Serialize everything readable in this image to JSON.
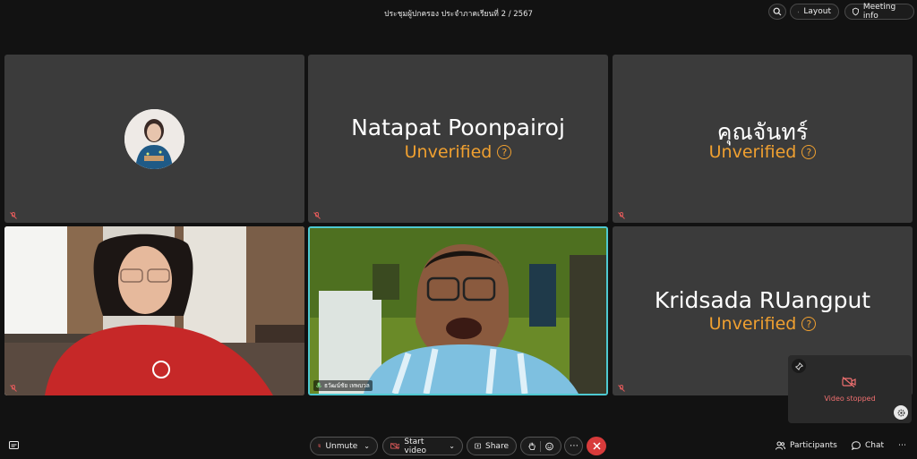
{
  "meeting": {
    "title": "ประชุมผู้ปกครอง ประจำภาคเรียนที่ 2 / 2567"
  },
  "top_buttons": {
    "layout": "Layout",
    "info": "Meeting info"
  },
  "participants": [
    {
      "name": "",
      "status": ""
    },
    {
      "name": "Natapat Poonpairoj",
      "status": "Unverified"
    },
    {
      "name": "คุณจันทร์",
      "status": "Unverified"
    },
    {
      "name": "",
      "status": ""
    },
    {
      "name": "",
      "status": "",
      "video_label": "ธวัฒน์ชัย เทพบวล"
    },
    {
      "name": "Kridsada RUangput",
      "status": "Unverified"
    }
  ],
  "self_view": {
    "text": "Video stopped"
  },
  "controls": {
    "unmute": "Unmute",
    "start_video": "Start video",
    "share": "Share",
    "participants": "Participants",
    "chat": "Chat"
  },
  "colors": {
    "unverified": "#f0a030",
    "active_speaker": "#4ec9d1",
    "leave": "#d83b3b",
    "stopped": "#f07070"
  }
}
